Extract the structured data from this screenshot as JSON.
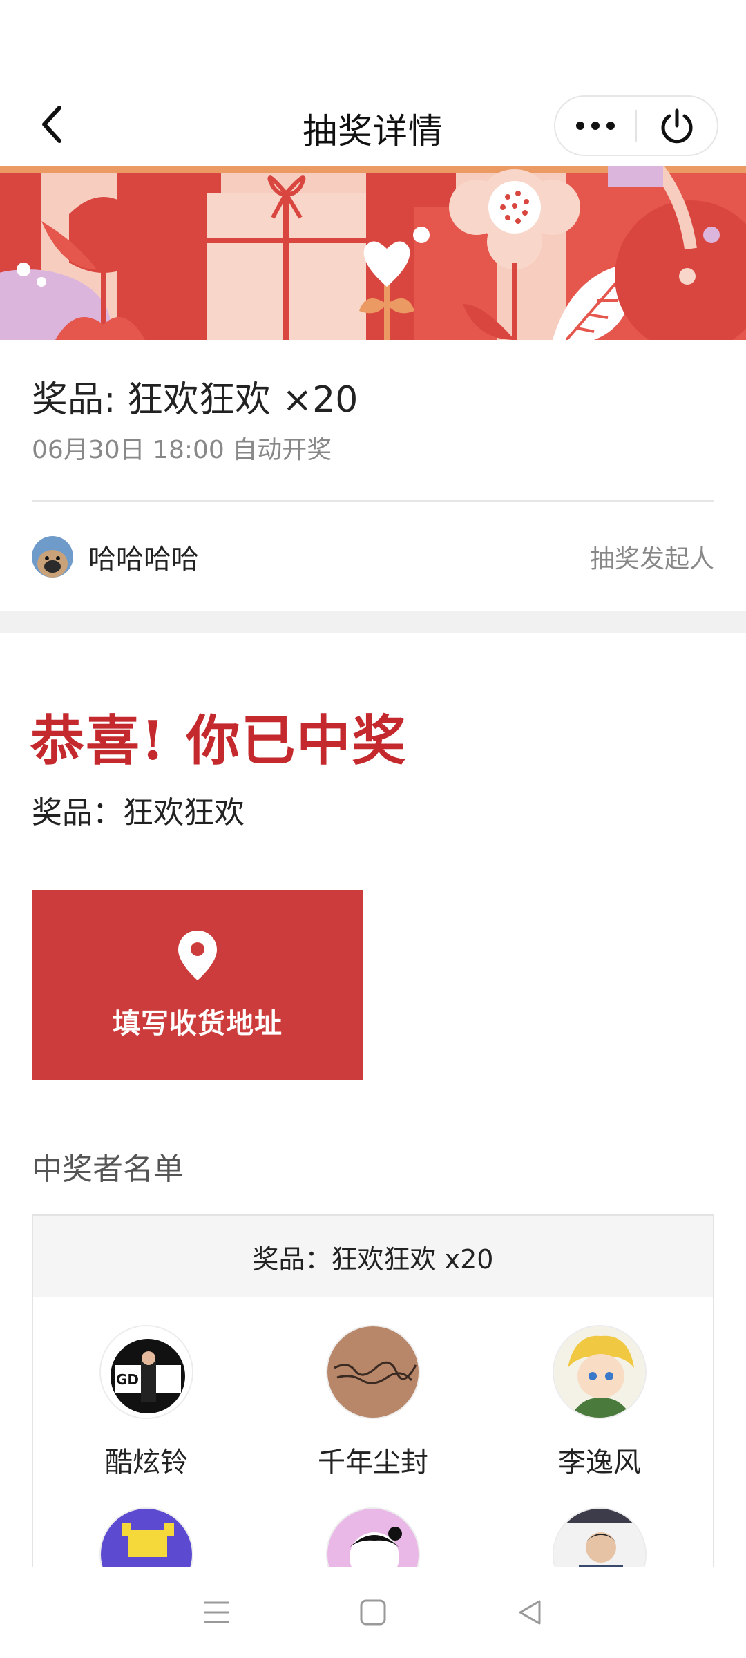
{
  "header": {
    "title": "抽奖详情",
    "back_icon": "chevron-left-icon",
    "more_icon": "more-dots-icon",
    "close_icon": "power-icon"
  },
  "banner": {
    "colors": {
      "red": "#d9463f",
      "pink": "#f6cdbf",
      "lilac": "#dcb5dc",
      "orange": "#ec9a63"
    }
  },
  "prize": {
    "title": "奖品: 狂欢狂欢 ×20",
    "draw_time": "06月30日 18:00 自动开奖"
  },
  "initiator": {
    "name": "哈哈哈哈",
    "role": "抽奖发起人"
  },
  "result": {
    "headline": "恭喜! 你已中奖",
    "prize_line": "奖品：狂欢狂欢",
    "accent_color": "#c3292d"
  },
  "address_button": {
    "label": "填写收货地址",
    "icon": "location-pin-icon",
    "color": "#cd3c3c"
  },
  "winners": {
    "section_title": "中奖者名单",
    "header": "奖品：狂欢狂欢 x20",
    "list": [
      {
        "name": "酷炫铃"
      },
      {
        "name": "千年尘封"
      },
      {
        "name": "李逸风"
      },
      {
        "name": ""
      },
      {
        "name": ""
      },
      {
        "name": ""
      }
    ]
  },
  "nav": {
    "menu_icon": "menu-icon",
    "home_icon": "home-square-icon",
    "back_icon": "back-triangle-icon"
  }
}
